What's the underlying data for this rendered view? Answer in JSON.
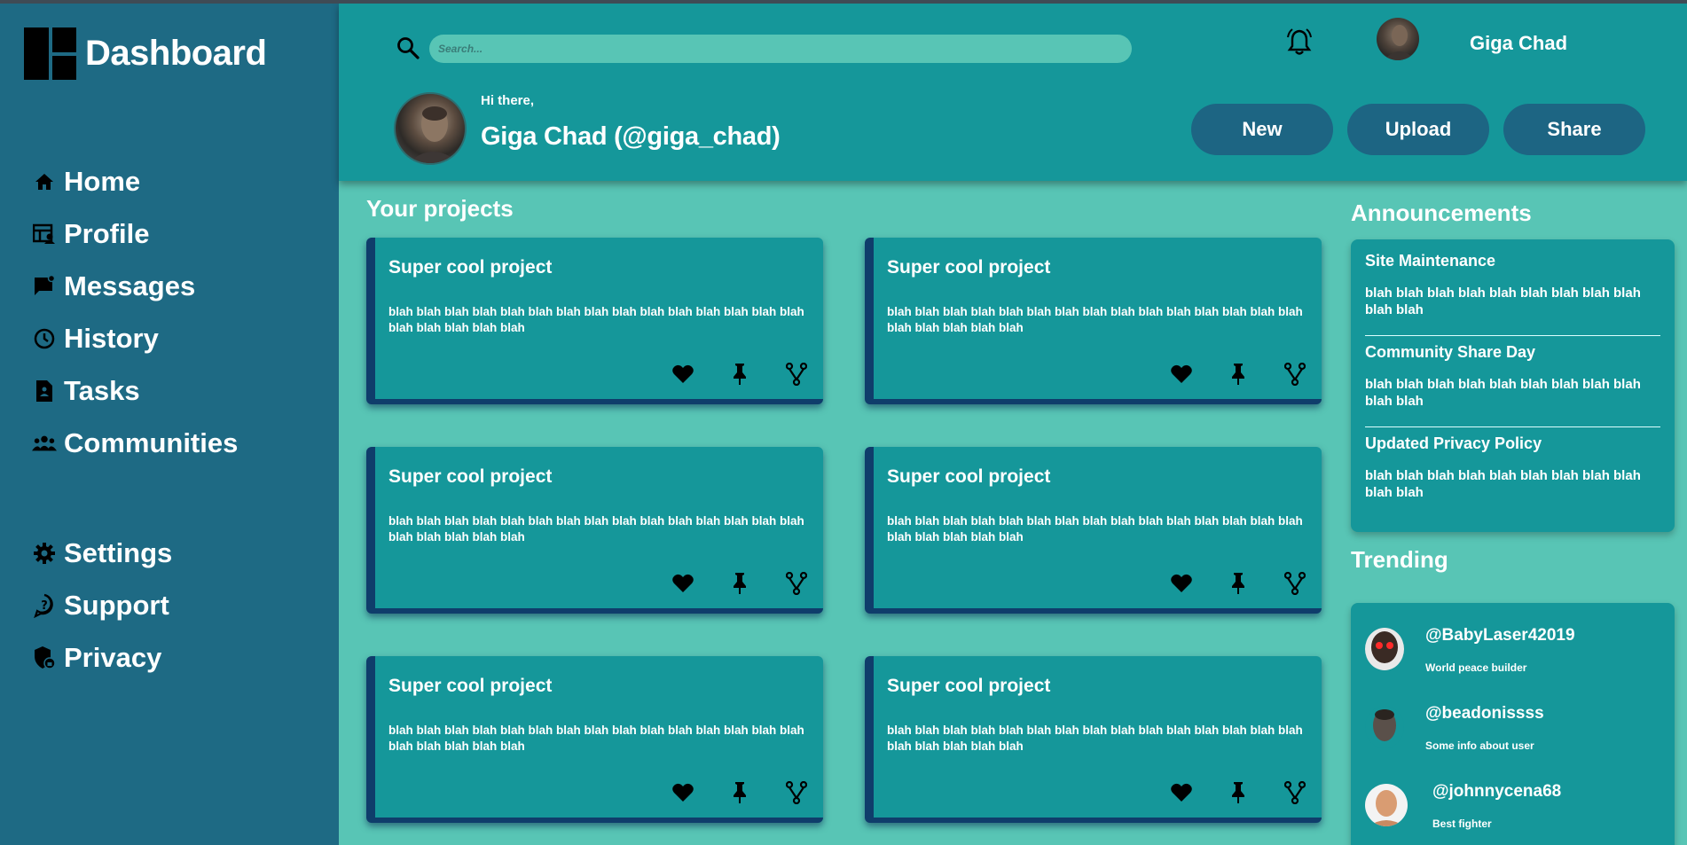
{
  "sidebar": {
    "brand": "Dashboard",
    "nav_main": [
      {
        "label": "Home",
        "icon": "home-icon"
      },
      {
        "label": "Profile",
        "icon": "profile-icon"
      },
      {
        "label": "Messages",
        "icon": "messages-icon"
      },
      {
        "label": "History",
        "icon": "history-icon"
      },
      {
        "label": "Tasks",
        "icon": "tasks-icon"
      },
      {
        "label": "Communities",
        "icon": "communities-icon"
      }
    ],
    "nav_secondary": [
      {
        "label": "Settings",
        "icon": "gear-icon"
      },
      {
        "label": "Support",
        "icon": "support-icon"
      },
      {
        "label": "Privacy",
        "icon": "privacy-icon"
      }
    ]
  },
  "header": {
    "search_placeholder": "Search...",
    "user_name": "Giga Chad",
    "greeting": "Hi there,",
    "full_name": "Giga Chad (@giga_chad)",
    "buttons": {
      "new": "New",
      "upload": "Upload",
      "share": "Share"
    }
  },
  "projects": {
    "title": "Your projects",
    "items": [
      {
        "title": "Super cool project",
        "text": "blah blah blah blah blah blah blah blah blah blah blah blah blah blah blah blah blah blah blah blah"
      },
      {
        "title": "Super cool project",
        "text": "blah blah blah blah blah blah blah blah blah blah blah blah blah blah blah blah blah blah blah blah"
      },
      {
        "title": "Super cool project",
        "text": "blah blah blah blah blah blah blah blah blah blah blah blah blah blah blah blah blah blah blah blah"
      },
      {
        "title": "Super cool project",
        "text": "blah blah blah blah blah blah blah blah blah blah blah blah blah blah blah blah blah blah blah blah"
      },
      {
        "title": "Super cool project",
        "text": "blah blah blah blah blah blah blah blah blah blah blah blah blah blah blah blah blah blah blah blah"
      },
      {
        "title": "Super cool project",
        "text": "blah blah blah blah blah blah blah blah blah blah blah blah blah blah blah blah blah blah blah blah"
      }
    ]
  },
  "announcements": {
    "title": "Announcements",
    "items": [
      {
        "title": "Site Maintenance",
        "text": "blah blah blah blah blah blah blah blah blah blah blah"
      },
      {
        "title": "Community Share Day",
        "text": "blah blah blah blah blah blah blah blah blah blah blah"
      },
      {
        "title": "Updated Privacy Policy",
        "text": "blah blah blah blah blah blah blah blah blah blah blah"
      }
    ]
  },
  "trending": {
    "title": "Trending",
    "items": [
      {
        "handle": "@BabyLaser42019",
        "info": "World peace builder"
      },
      {
        "handle": "@beadonissss",
        "info": "Some info about user"
      },
      {
        "handle": "@johnnycena68",
        "info": "Best fighter"
      }
    ]
  },
  "colors": {
    "sidebar": "#1e6a84",
    "header": "#15979a",
    "background": "#58c5b5",
    "button": "#1d6583",
    "card_accent": "#0f3d6b"
  }
}
